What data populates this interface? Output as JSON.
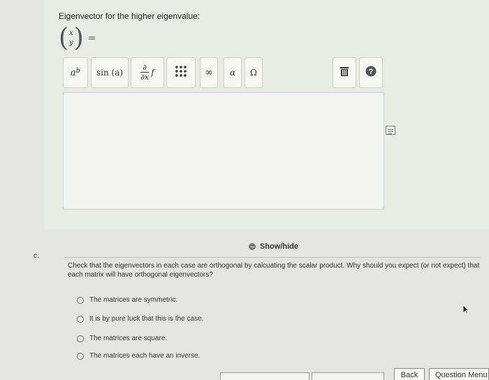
{
  "eigen": {
    "label": "Eigenvector for the higher eigenvalue:",
    "vec_top": "x",
    "vec_bottom": "y",
    "equals": "="
  },
  "toolbar": {
    "power_base": "a",
    "power_exp": "b",
    "sin": "sin (a)",
    "deriv_num": "∂",
    "deriv_den": "∂x",
    "deriv_f": "f",
    "infinity": "∞",
    "alpha": "α",
    "omega": "Ω"
  },
  "colors": {
    "help_button": "#555555"
  },
  "section_c": {
    "part_label": "c.",
    "showhide": "Show/hide",
    "question": "Check that the eigenvectors in each case are orthogonal by calcuating the scalar product. Why should you expect (or not expect) that each matrix will have orthogonal eigenvectors?",
    "options": [
      "The matrices are symmetric.",
      "It is by pure luck that this is the case.",
      "The matrices are square.",
      "The matrices each have an inverse."
    ]
  },
  "nav": {
    "back": "Back",
    "question_menu": "Question Menu"
  }
}
